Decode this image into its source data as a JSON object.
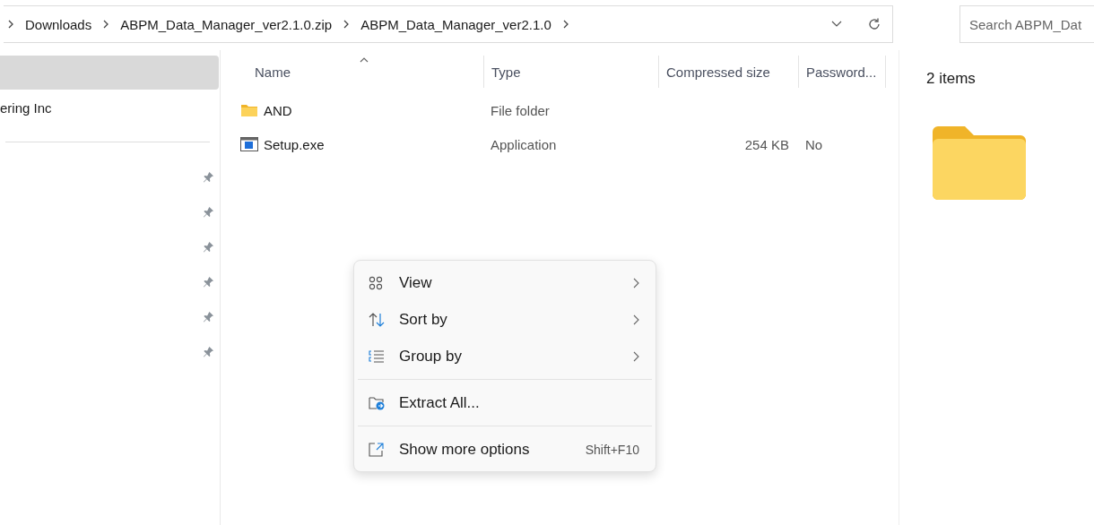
{
  "breadcrumb": [
    "Downloads",
    "ABPM_Data_Manager_ver2.1.0.zip",
    "ABPM_Data_Manager_ver2.1.0"
  ],
  "search": {
    "placeholder": "Search ABPM_Dat"
  },
  "sidebar": {
    "items": [
      {
        "selected": true
      },
      {
        "label": "ering Inc",
        "selected": false
      }
    ],
    "quick_access": [
      {
        "pinned": true
      },
      {
        "pinned": true
      },
      {
        "pinned": true
      },
      {
        "pinned": true
      },
      {
        "pinned": true
      },
      {
        "pinned": true
      }
    ]
  },
  "table": {
    "columns": [
      "Name",
      "Type",
      "Compressed size",
      "Password..."
    ],
    "rows": [
      {
        "kind": "folder",
        "name": "AND",
        "type": "File folder"
      },
      {
        "kind": "app",
        "name": "Setup.exe",
        "type": "Application",
        "size": "254 KB",
        "password": "No"
      }
    ]
  },
  "details": {
    "count": "2 items"
  },
  "context_menu": [
    {
      "kind": "view",
      "label": "View",
      "submenu": true
    },
    {
      "kind": "sort",
      "label": "Sort by",
      "submenu": true
    },
    {
      "kind": "group",
      "label": "Group by",
      "submenu": true
    },
    {
      "kind": "separator"
    },
    {
      "kind": "extract",
      "label": "Extract All...",
      "submenu": false
    },
    {
      "kind": "separator"
    },
    {
      "kind": "more",
      "label": "Show more options",
      "shortcut": "Shift+F10",
      "submenu": false
    }
  ]
}
